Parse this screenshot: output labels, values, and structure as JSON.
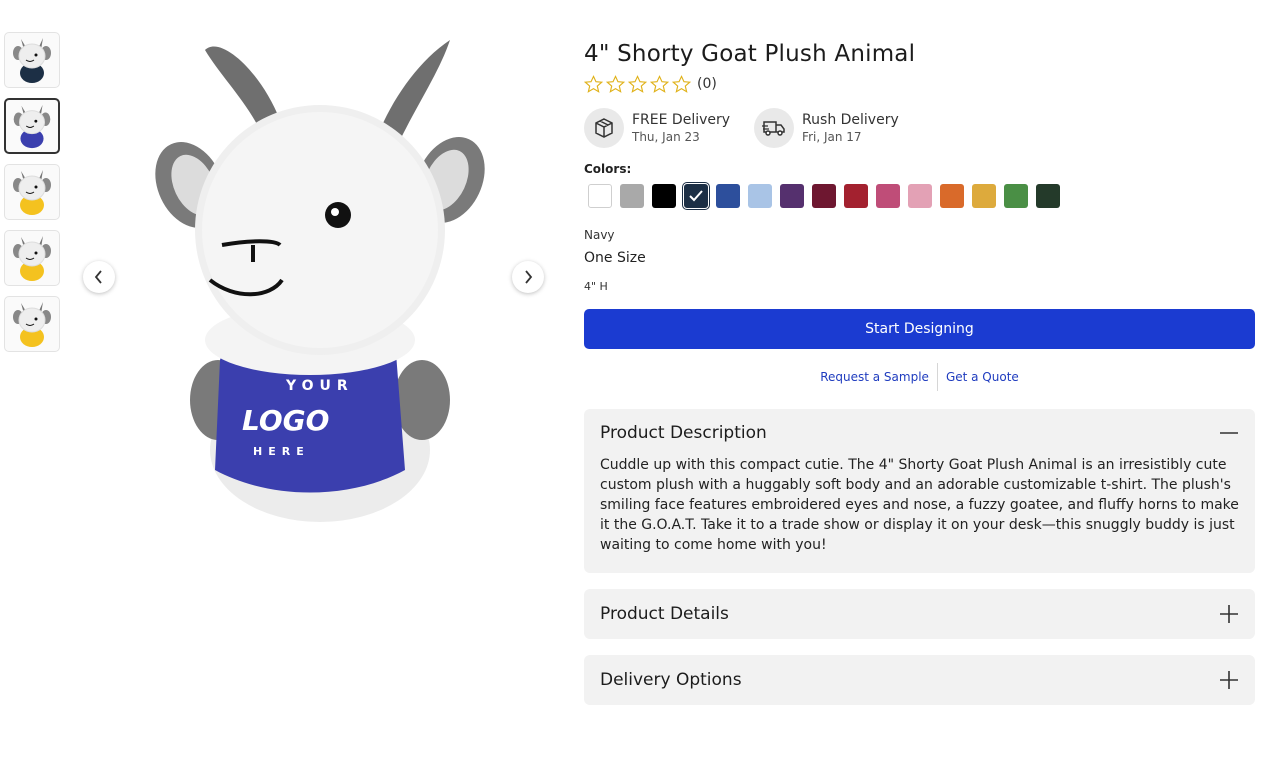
{
  "product": {
    "title": "4\" Shorty Goat Plush Animal",
    "rating_count": "(0)",
    "rating_value": 0,
    "rating_max": 5
  },
  "delivery": [
    {
      "icon": "box-icon",
      "label": "FREE Delivery",
      "date": "Thu, Jan 23"
    },
    {
      "icon": "truck-icon",
      "label": "Rush Delivery",
      "date": "Fri, Jan 17"
    }
  ],
  "colors": {
    "label": "Colors:",
    "selected_name": "Navy",
    "swatches": [
      "#ffffff",
      "#a9a9a9",
      "#000000",
      "#1c2f45",
      "#2d4f9c",
      "#a9c4e6",
      "#55306e",
      "#6e1730",
      "#a3212f",
      "#bf4d78",
      "#e3a1b5",
      "#d96a2a",
      "#ddaa3c",
      "#4a8f45",
      "#243a2a"
    ],
    "selected_index": 3
  },
  "size": "One Size",
  "dimensions": "4\" H",
  "actions": {
    "start_designing": "Start Designing",
    "request_sample": "Request a Sample",
    "get_quote": "Get a Quote"
  },
  "panels": {
    "description": {
      "title": "Product Description",
      "body": "Cuddle up with this compact cutie. The 4\" Shorty Goat Plush Animal is an irresistibly cute custom plush with a huggably soft body and an adorable customizable t-shirt. The plush's smiling face features embroidered eyes and nose, a fuzzy goatee, and fluffy horns to make it the G.O.A.T. Take it to a trade show or display it on your desk—this snuggly buddy is just waiting to come home with you!"
    },
    "details": {
      "title": "Product Details"
    },
    "delivery_options": {
      "title": "Delivery Options"
    }
  },
  "image": {
    "shirt_text_top": "YOUR",
    "shirt_text_main": "LOGO",
    "shirt_text_bottom": "HERE"
  },
  "thumbnails": [
    {
      "shirt": "#1c2f45"
    },
    {
      "shirt": "#3b3fae"
    },
    {
      "shirt": "#f4c21f"
    },
    {
      "shirt": "#f4c21f"
    },
    {
      "shirt": "#f4c21f"
    }
  ],
  "selected_thumbnail": 1
}
